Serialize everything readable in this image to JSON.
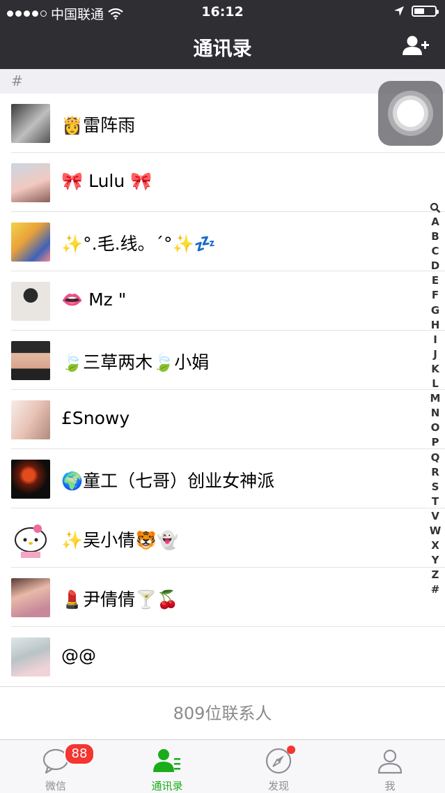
{
  "status": {
    "carrier": "中国联通",
    "time": "16:12"
  },
  "nav": {
    "title": "通讯录"
  },
  "section": {
    "letter": "#"
  },
  "contacts": [
    {
      "name": "👸雷阵雨"
    },
    {
      "name": "🎀 Lulu 🎀"
    },
    {
      "name": "✨°.毛.线。´°✨💤"
    },
    {
      "name": "👄 Mz \""
    },
    {
      "name": "🍃三草两木🍃小娟"
    },
    {
      "name": "£Snowy"
    },
    {
      "name": "🌍童工（七哥）创业女神派"
    },
    {
      "name": "✨吴小倩🐯👻"
    },
    {
      "name": "💄尹倩倩🍸🍒"
    },
    {
      "name": "@@"
    }
  ],
  "footer": {
    "count": "809位联系人"
  },
  "index_letters": [
    "A",
    "B",
    "C",
    "D",
    "E",
    "F",
    "G",
    "H",
    "I",
    "J",
    "K",
    "L",
    "M",
    "N",
    "O",
    "P",
    "Q",
    "R",
    "S",
    "T",
    "V",
    "W",
    "X",
    "Y",
    "Z",
    "#"
  ],
  "tabs": [
    {
      "label": "微信",
      "icon": "chat-bubble-icon",
      "badge": "88"
    },
    {
      "label": "通讯录",
      "icon": "contacts-icon"
    },
    {
      "label": "发现",
      "icon": "compass-icon"
    },
    {
      "label": "我",
      "icon": "person-icon"
    }
  ],
  "colors": {
    "nav_bg": "#2e2e33",
    "accent": "#1aad19",
    "badge": "#f43530",
    "section_bg": "#efeff4"
  }
}
